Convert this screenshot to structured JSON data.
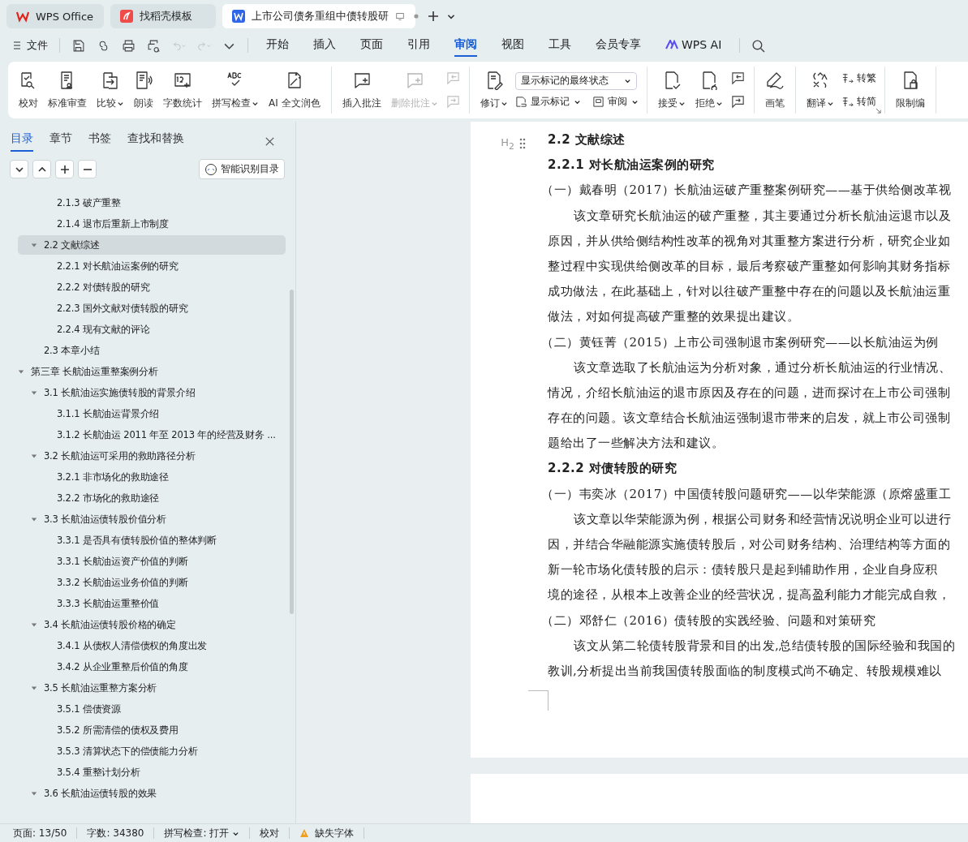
{
  "window_tabs": [
    {
      "label": "WPS Office",
      "kind": "home",
      "selected": false
    },
    {
      "label": "找稻壳模板",
      "kind": "template",
      "selected": false
    },
    {
      "label": "上市公司债务重组中债转股研",
      "kind": "doc",
      "selected": true
    }
  ],
  "menu": {
    "file": "文件",
    "tabs": [
      {
        "label": "开始",
        "selected": false
      },
      {
        "label": "插入",
        "selected": false
      },
      {
        "label": "页面",
        "selected": false
      },
      {
        "label": "引用",
        "selected": false
      },
      {
        "label": "审阅",
        "selected": true
      },
      {
        "label": "视图",
        "selected": false
      },
      {
        "label": "工具",
        "selected": false
      },
      {
        "label": "会员专享",
        "selected": false
      }
    ],
    "ai": "WPS AI"
  },
  "ribbon": [
    {
      "items": [
        {
          "kind": "big",
          "label": "校对",
          "caret": false,
          "disabled": false
        },
        {
          "kind": "big",
          "label": "标准审查",
          "caret": false,
          "disabled": false
        },
        {
          "kind": "big",
          "label": "比较",
          "caret": true,
          "disabled": false
        },
        {
          "kind": "big",
          "label": "朗读",
          "caret": false,
          "disabled": false
        },
        {
          "kind": "big",
          "label": "字数统计",
          "caret": false,
          "disabled": false
        },
        {
          "kind": "big",
          "label": "拼写检查",
          "caret": true,
          "disabled": false
        },
        {
          "kind": "big",
          "label": "AI 全文润色",
          "caret": false,
          "disabled": false
        }
      ]
    },
    {
      "items": [
        {
          "kind": "big",
          "label": "插入批注",
          "caret": false,
          "disabled": false
        },
        {
          "kind": "big",
          "label": "删除批注",
          "caret": true,
          "disabled": true
        },
        {
          "kind": "pair",
          "disabled": true
        }
      ]
    },
    {
      "items": [
        {
          "kind": "big",
          "label": "修订",
          "caret": true,
          "disabled": false
        },
        {
          "kind": "panel",
          "select": "显示标记的最终状态",
          "buttons": [
            {
              "label": "显示标记",
              "caret": true
            },
            {
              "label": "审阅",
              "caret": true
            }
          ]
        }
      ]
    },
    {
      "items": [
        {
          "kind": "big",
          "label": "接受",
          "caret": true,
          "disabled": false
        },
        {
          "kind": "big",
          "label": "拒绝",
          "caret": true,
          "disabled": false
        },
        {
          "kind": "pair",
          "disabled": false
        }
      ]
    },
    {
      "items": [
        {
          "kind": "big",
          "label": "画笔",
          "caret": false,
          "disabled": false
        }
      ]
    },
    {
      "items": [
        {
          "kind": "big",
          "label": "翻译",
          "caret": true,
          "disabled": false
        },
        {
          "kind": "stack",
          "buttons": [
            {
              "label": "转繁"
            },
            {
              "label": "转简"
            }
          ]
        }
      ],
      "launcher": true
    },
    {
      "items": [
        {
          "kind": "big",
          "label": "限制编",
          "caret": false,
          "disabled": false
        }
      ]
    }
  ],
  "sidebar": {
    "tabs": [
      {
        "label": "目录",
        "selected": true
      },
      {
        "label": "章节",
        "selected": false
      },
      {
        "label": "书签",
        "selected": false
      },
      {
        "label": "查找和替换",
        "selected": false
      }
    ],
    "smart_button": "智能识别目录",
    "toc": [
      {
        "children": [
          {
            "children": [
              {
                "title": "2.1.3 破产重整",
                "selected": false
              },
              {
                "title": "2.1.4 退市后重新上市制度",
                "selected": false
              }
            ]
          },
          {
            "title": "2.2 文献综述",
            "selected": true,
            "expanded": true,
            "children": [
              {
                "title": "2.2.1 对长航油运案例的研究",
                "selected": false
              },
              {
                "title": "2.2.2 对债转股的研究",
                "selected": false
              },
              {
                "title": "2.2.3 国外文献对债转股的研究",
                "selected": false
              },
              {
                "title": "2.2.4 现有文献的评论",
                "selected": false
              }
            ]
          },
          {
            "title": "2.3 本章小结",
            "selected": false
          }
        ]
      },
      {
        "title": "第三章 长航油运重整案例分析",
        "selected": false,
        "expanded": true,
        "children": [
          {
            "title": "3.1 长航油运实施债转股的背景介绍",
            "selected": false,
            "expanded": true,
            "children": [
              {
                "title": "3.1.1 长航油运背景介绍",
                "selected": false
              },
              {
                "title": "3.1.2 长航油运 2011 年至 2013 年的经营及财务 ...",
                "selected": false
              }
            ]
          },
          {
            "title": "3.2 长航油运可采用的救助路径分析",
            "selected": false,
            "expanded": true,
            "children": [
              {
                "title": "3.2.1 非市场化的救助途径",
                "selected": false
              },
              {
                "title": "3.2.2 市场化的救助途径",
                "selected": false
              }
            ]
          },
          {
            "title": "3.3 长航油运债转股价值分析",
            "selected": false,
            "expanded": true,
            "children": [
              {
                "title": "3.3.1 是否具有债转股价值的整体判断",
                "selected": false
              },
              {
                "title": "3.3.1 长航油运资产价值的判断",
                "selected": false
              },
              {
                "title": "3.3.2 长航油运业务价值的判断",
                "selected": false
              },
              {
                "title": "3.3.3 长航油运重整价值",
                "selected": false
              }
            ]
          },
          {
            "title": "3.4 长航油运债转股价格的确定",
            "selected": false,
            "expanded": true,
            "children": [
              {
                "title": "3.4.1 从债权人清偿债权的角度出发",
                "selected": false
              },
              {
                "title": "3.4.2 从企业重整后价值的角度",
                "selected": false
              }
            ]
          },
          {
            "title": "3.5 长航油运重整方案分析",
            "selected": false,
            "expanded": true,
            "children": [
              {
                "title": "3.5.1 偿债资源",
                "selected": false
              },
              {
                "title": "3.5.2 所需清偿的债权及费用",
                "selected": false
              },
              {
                "title": "3.5.3 清算状态下的偿债能力分析",
                "selected": false
              },
              {
                "title": "3.5.4 重整计划分析",
                "selected": false
              }
            ]
          },
          {
            "title": "3.6 长航油运债转股的效果",
            "selected": false,
            "expanded": true
          }
        ]
      }
    ]
  },
  "document": {
    "heading_marker": "H$_{2}$",
    "blocks": [
      {
        "kind": "heading2",
        "lines": [
          "2.2 文献综述"
        ]
      },
      {
        "kind": "heading3",
        "lines": [
          "2.2.1 对长航油运案例的研究"
        ]
      },
      {
        "kind": "ref",
        "lines": [
          "（一）戴春明（2017）长航油运破产重整案例研究——基于供给侧改革视"
        ]
      },
      {
        "kind": "para",
        "lines": [
          "该文章研究长航油运的破产重整，其主要通过分析长航油运退市以及",
          "原因，并从供给侧结构性改革的视角对其重整方案进行分析，研究企业如",
          "整过程中实现供给侧改革的目标，最后考察破产重整如何影响其财务指标",
          "成功做法，在此基础上，针对以往破产重整中存在的问题以及长航油运重",
          "做法，对如何提高破产重整的效果提出建议。"
        ]
      },
      {
        "kind": "ref",
        "lines": [
          "（二）黄钰菁（2015）上市公司强制退市案例研究——以长航油运为例"
        ]
      },
      {
        "kind": "para",
        "lines": [
          "该文章选取了长航油运为分析对象，通过分析长航油运的行业情况、",
          "情况，介绍长航油运的退市原因及存在的问题，进而探讨在上市公司强制",
          "存在的问题。该文章结合长航油运强制退市带来的启发，就上市公司强制",
          "题给出了一些解决方法和建议。"
        ]
      },
      {
        "kind": "heading3",
        "lines": [
          "2.2.2 对债转股的研究"
        ]
      },
      {
        "kind": "ref",
        "lines": [
          "（一）韦奕冰（2017）中国债转股问题研究——以华荣能源（原熔盛重工"
        ]
      },
      {
        "kind": "para",
        "lines": [
          "该文章以华荣能源为例，根据公司财务和经营情况说明企业可以进行",
          "因，并结合华融能源实施债转股后，对公司财务结构、治理结构等方面的",
          "新一轮市场化债转股的启示：债转股只是起到辅助作用，企业自身应积",
          "境的途径，从根本上改善企业的经营状况，提高盈利能力才能完成自救，"
        ]
      },
      {
        "kind": "ref",
        "lines": [
          "（二）邓舒仁（2016）债转股的实践经验、问题和对策研究"
        ]
      },
      {
        "kind": "para",
        "lines": [
          "该文从第二轮债转股背景和目的出发,总结债转股的国际经验和我国的",
          "教训,分析提出当前我国债转股面临的制度模式尚不确定、转股规模难以"
        ]
      }
    ]
  },
  "status_bar": [
    {
      "kind": "text",
      "label": "页面: 13/50"
    },
    {
      "kind": "text",
      "label": "字数: 34380"
    },
    {
      "kind": "dropdown",
      "label": "拼写检查: 打开"
    },
    {
      "kind": "text",
      "label": "校对"
    },
    {
      "kind": "warning",
      "label": "缺失字体"
    }
  ]
}
